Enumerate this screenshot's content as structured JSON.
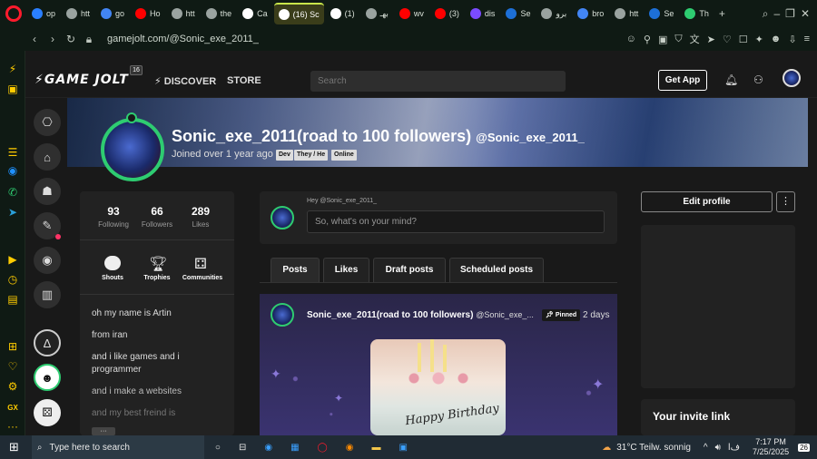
{
  "browser": {
    "tabs": [
      {
        "label": "op",
        "color": "#2a7fff"
      },
      {
        "label": "htt",
        "color": "#9aa3a0"
      },
      {
        "label": "go",
        "color": "#4285f4"
      },
      {
        "label": "Ho",
        "color": "#ff0000"
      },
      {
        "label": "htt",
        "color": "#9aa3a0"
      },
      {
        "label": "the",
        "color": "#9aa3a0"
      },
      {
        "label": "Ca",
        "color": "#ffffff"
      },
      {
        "label": "(16) Sc",
        "color": "#ffffff",
        "active": true
      },
      {
        "label": "(1)",
        "color": "#ffffff"
      },
      {
        "label": "بهـ",
        "color": "#9aa3a0"
      },
      {
        "label": "wv",
        "color": "#ff0000"
      },
      {
        "label": "(3)",
        "color": "#ff0000"
      },
      {
        "label": "dis",
        "color": "#7b4bff"
      },
      {
        "label": "Se",
        "color": "#1d6fd6"
      },
      {
        "label": "برو",
        "color": "#9aa3a0"
      },
      {
        "label": "bro",
        "color": "#4285f4"
      },
      {
        "label": "htt",
        "color": "#9aa3a0"
      },
      {
        "label": "Se",
        "color": "#1d6fd6"
      },
      {
        "label": "Th",
        "color": "#2ecc71"
      }
    ],
    "new_tab": "+",
    "url": "gamejolt.com/@Sonic_exe_2011_"
  },
  "header": {
    "logo": "GAME JOLT",
    "notif_count": "16",
    "discover": "DISCOVER",
    "store": "STORE",
    "search_placeholder": "Search",
    "get_app": "Get App"
  },
  "profile": {
    "name": "Sonic_exe_2011(road to 100 followers)",
    "handle": "@Sonic_exe_2011_",
    "joined": "Joined over 1 year ago",
    "dot": "•",
    "tags": [
      "Dev",
      "They / He",
      "Online"
    ],
    "stats": [
      {
        "value": "93",
        "label": "Following"
      },
      {
        "value": "66",
        "label": "Followers"
      },
      {
        "value": "289",
        "label": "Likes"
      }
    ],
    "quicklinks": [
      "Shouts",
      "Trophies",
      "Communities"
    ],
    "bio": [
      "oh my name is Artin",
      "from iran",
      "and i like games and i programmer",
      "and i make a websites",
      "and my best freind is"
    ],
    "bio_more": "···"
  },
  "composer": {
    "greeting": "Hey @Sonic_exe_2011_",
    "placeholder": "So, what's on your mind?"
  },
  "tabs": [
    "Posts",
    "Likes",
    "Draft posts",
    "Scheduled posts"
  ],
  "post": {
    "author": "Sonic_exe_2011(road to 100 followers)",
    "handle": "@Sonic_exe_...",
    "pinned": "Pinned",
    "time": "2 days",
    "cake_text": "Happy Birthday"
  },
  "right": {
    "edit_profile": "Edit profile",
    "more": "⋮",
    "invite_title": "Your invite link"
  },
  "taskbar": {
    "search_placeholder": "Type here to search",
    "weather": "31°C  Teilw. sonnig",
    "lang": "ﻑﺍ",
    "time": "7:17 PM",
    "date": "7/25/2025",
    "notif": "26"
  }
}
